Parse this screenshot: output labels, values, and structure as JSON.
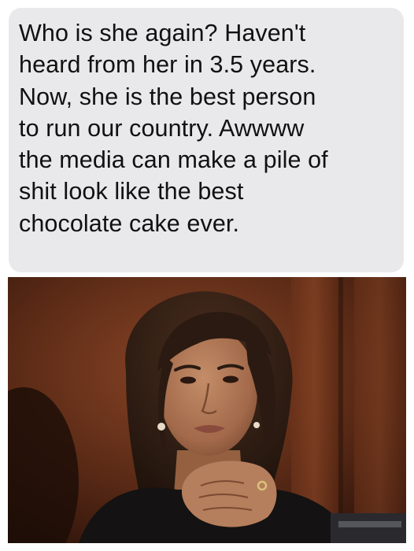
{
  "post": {
    "text": "Who is she again? Haven't\nheard from her in 3.5 years.\nNow, she is the best person\nto run our country. Awwww\nthe media can make a pile of\nshit look like the best\nchocolate cake ever."
  },
  "photo": {
    "subject": "woman-portrait",
    "colors": {
      "background": "#5a2a16",
      "wood": "#7a3a1e",
      "skin": "#b07a58",
      "hair": "#2a1a12",
      "jacket": "#141212"
    }
  }
}
